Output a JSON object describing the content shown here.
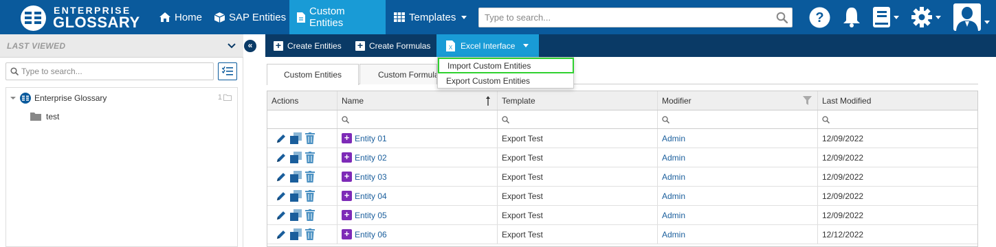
{
  "brand": {
    "line1": "ENTERPRISE",
    "line2": "GLOSSARY"
  },
  "nav": {
    "home": "Home",
    "sap_entities": "SAP Entities",
    "custom_entities": "Custom Entities",
    "templates": "Templates"
  },
  "search": {
    "placeholder": "Type to search..."
  },
  "left_panel": {
    "last_viewed": "LAST VIEWED",
    "search_placeholder": "Type to search...",
    "tree": {
      "root_label": "Enterprise Glossary",
      "root_count": "1",
      "child_label": "test"
    }
  },
  "toolbar": {
    "create_entities": "Create Entities",
    "create_formulas": "Create Formulas",
    "excel_interface": "Excel Interface"
  },
  "excel_menu": {
    "import": "Import Custom Entities",
    "export": "Export Custom Entities"
  },
  "tabs": {
    "custom_entities": "Custom Entities",
    "custom_formulas": "Custom Formulas"
  },
  "grid": {
    "columns": {
      "actions": "Actions",
      "name": "Name",
      "template": "Template",
      "modifier": "Modifier",
      "last_modified": "Last Modified"
    },
    "rows": [
      {
        "name": "Entity 01",
        "template": "Export Test",
        "modifier": "Admin",
        "last_modified": "12/09/2022"
      },
      {
        "name": "Entity 02",
        "template": "Export Test",
        "modifier": "Admin",
        "last_modified": "12/09/2022"
      },
      {
        "name": "Entity 03",
        "template": "Export Test",
        "modifier": "Admin",
        "last_modified": "12/09/2022"
      },
      {
        "name": "Entity 04",
        "template": "Export Test",
        "modifier": "Admin",
        "last_modified": "12/09/2022"
      },
      {
        "name": "Entity 05",
        "template": "Export Test",
        "modifier": "Admin",
        "last_modified": "12/09/2022"
      },
      {
        "name": "Entity 06",
        "template": "Export Test",
        "modifier": "Admin",
        "last_modified": "12/12/2022"
      }
    ]
  },
  "colors": {
    "nav_bg": "#0a5a9c",
    "nav_active": "#199bd6",
    "toolbar_bg": "#0a3a66",
    "entity_badge": "#7d2bb7",
    "highlight": "#2ed12e"
  }
}
